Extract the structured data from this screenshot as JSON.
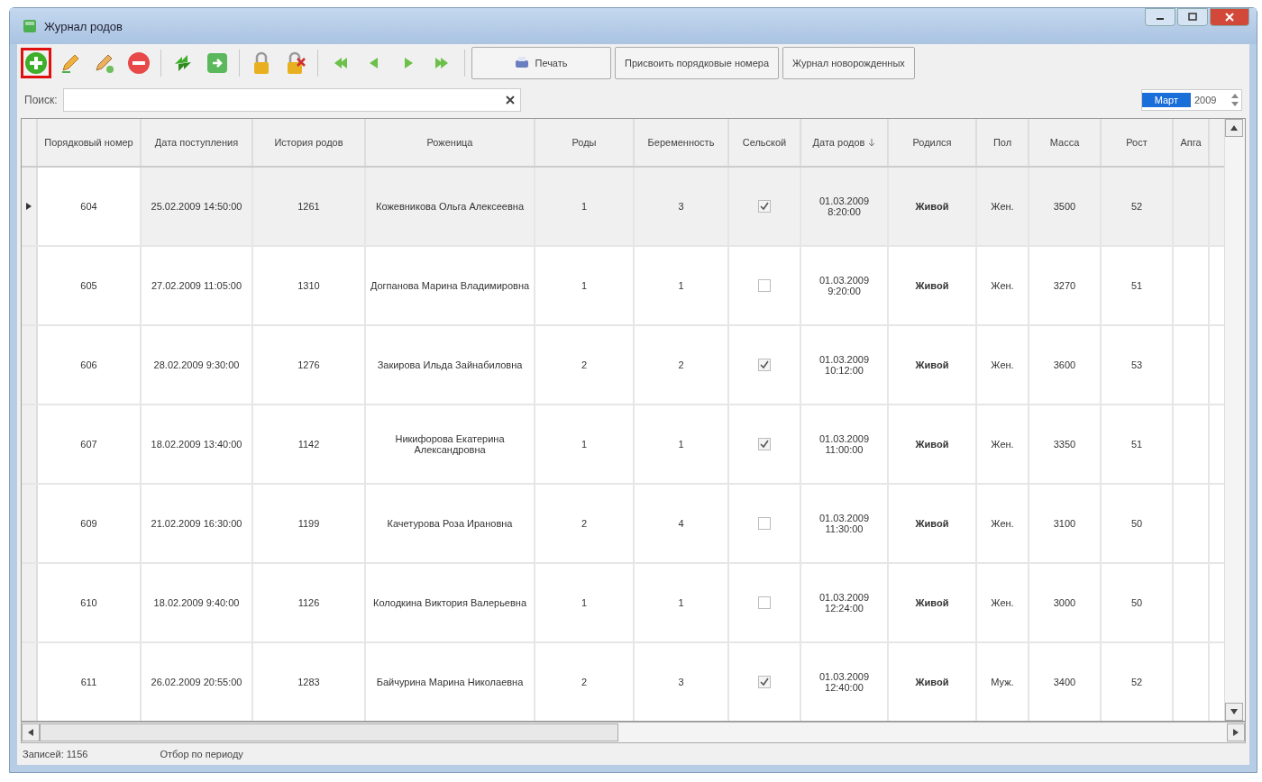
{
  "window": {
    "title": "Журнал родов"
  },
  "toolbar": [
    {
      "kind": "add",
      "highlighted": true
    },
    {
      "kind": "edit",
      "highlighted": false
    },
    {
      "kind": "edit-new",
      "highlighted": false
    },
    {
      "kind": "delete",
      "highlighted": false
    },
    {
      "kind": "sep"
    },
    {
      "kind": "refresh",
      "highlighted": false
    },
    {
      "kind": "export",
      "highlighted": false
    },
    {
      "kind": "sep"
    },
    {
      "kind": "lock",
      "highlighted": false
    },
    {
      "kind": "unlock",
      "highlighted": false
    },
    {
      "kind": "sep"
    },
    {
      "kind": "first",
      "highlighted": false
    },
    {
      "kind": "prev",
      "highlighted": false
    },
    {
      "kind": "next",
      "highlighted": false
    },
    {
      "kind": "last",
      "highlighted": false
    }
  ],
  "buttons": [
    {
      "kind": "print",
      "label": "Печать"
    },
    {
      "kind": "text",
      "label": "Присвоить порядковые номера"
    },
    {
      "kind": "text",
      "label": "Журнал новорожденных"
    }
  ],
  "search": {
    "label": "Поиск:"
  },
  "period": {
    "month": "Март",
    "year": "2009"
  },
  "table": {
    "columns": [
      {
        "label": "Порядковый номер",
        "sorted": false
      },
      {
        "label": "Дата поступления",
        "sorted": false
      },
      {
        "label": "История родов",
        "sorted": false
      },
      {
        "label": "Роженица",
        "sorted": false
      },
      {
        "label": "Роды",
        "sorted": false
      },
      {
        "label": "Беременность",
        "sorted": false
      },
      {
        "label": "Сельской",
        "sorted": false
      },
      {
        "label": "Дата родов",
        "sorted": true
      },
      {
        "label": "Родился",
        "sorted": false
      },
      {
        "label": "Пол",
        "sorted": false
      },
      {
        "label": "Масса",
        "sorted": false
      },
      {
        "label": "Рост",
        "sorted": false
      },
      {
        "label": "Апга",
        "sorted": false
      }
    ],
    "rows": [
      {
        "selected": true,
        "cells": [
          "604",
          "25.02.2009 14:50:00",
          "1261",
          "Кожевникова Ольга Алексеевна",
          "1",
          "3",
          {
            "checked": true
          },
          "01.03.2009 8:20:00",
          "Живой",
          "Жен.",
          "3500",
          "52"
        ]
      },
      {
        "selected": false,
        "cells": [
          "605",
          "27.02.2009 11:05:00",
          "1310",
          "Догпанова Марина Владимировна",
          "1",
          "1",
          {
            "checked": false
          },
          "01.03.2009 9:20:00",
          "Живой",
          "Жен.",
          "3270",
          "51"
        ]
      },
      {
        "selected": false,
        "cells": [
          "606",
          "28.02.2009 9:30:00",
          "1276",
          "Закирова Ильда Зайнабиловна",
          "2",
          "2",
          {
            "checked": true
          },
          "01.03.2009 10:12:00",
          "Живой",
          "Жен.",
          "3600",
          "53"
        ]
      },
      {
        "selected": false,
        "cells": [
          "607",
          "18.02.2009 13:40:00",
          "1142",
          "Никифорова Екатерина Александровна",
          "1",
          "1",
          {
            "checked": true
          },
          "01.03.2009 11:00:00",
          "Живой",
          "Жен.",
          "3350",
          "51"
        ]
      },
      {
        "selected": false,
        "cells": [
          "609",
          "21.02.2009 16:30:00",
          "1199",
          "Качетурова Роза Ирановна",
          "2",
          "4",
          {
            "checked": false
          },
          "01.03.2009 11:30:00",
          "Живой",
          "Жен.",
          "3100",
          "50"
        ]
      },
      {
        "selected": false,
        "cells": [
          "610",
          "18.02.2009 9:40:00",
          "1126",
          "Колодкина Виктория Валерьевна",
          "1",
          "1",
          {
            "checked": false
          },
          "01.03.2009 12:24:00",
          "Живой",
          "Жен.",
          "3000",
          "50"
        ]
      },
      {
        "selected": false,
        "cells": [
          "611",
          "26.02.2009 20:55:00",
          "1283",
          "Байчурина Марина Николаевна",
          "2",
          "3",
          {
            "checked": true
          },
          "01.03.2009 12:40:00",
          "Живой",
          "Муж.",
          "3400",
          "52"
        ]
      }
    ]
  },
  "status_bar": {
    "records": "Записей: 1156",
    "filter": "Отбор по периоду"
  }
}
